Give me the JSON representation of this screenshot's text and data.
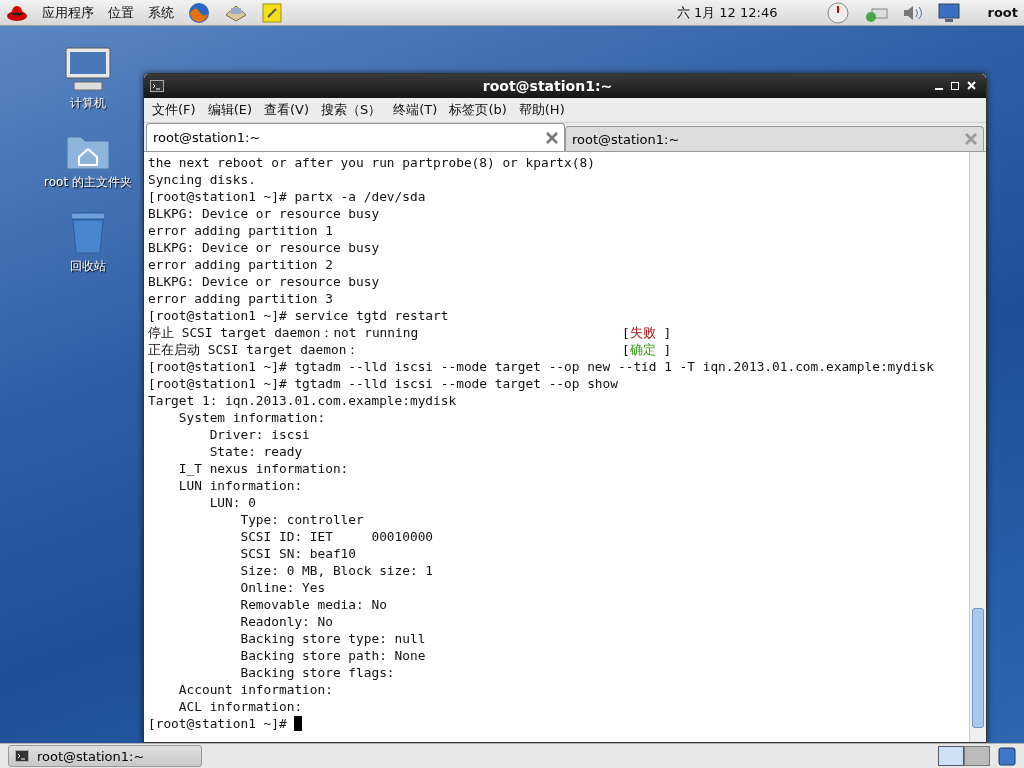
{
  "top_panel": {
    "menus": [
      "应用程序",
      "位置",
      "系统"
    ],
    "clock": "六 1月 12 12:46",
    "user": "root"
  },
  "desktop_icons": [
    {
      "kind": "computer",
      "label": "计算机"
    },
    {
      "kind": "home",
      "label": "root 的主文件夹"
    },
    {
      "kind": "trash",
      "label": "回收站"
    }
  ],
  "window": {
    "title": "root@station1:~",
    "menu": [
      "文件(F)",
      "编辑(E)",
      "查看(V)",
      "搜索（S）",
      "终端(T)",
      "标签页(b)",
      "帮助(H)"
    ],
    "tabs": [
      {
        "label": "root@station1:~",
        "selected": true
      },
      {
        "label": "root@station1:~",
        "selected": false
      }
    ],
    "lines": [
      {
        "text": "the next reboot or after you run partprobe(8) or kpartx(8)"
      },
      {
        "text": "Syncing disks."
      },
      {
        "text": "[root@station1 ~]# partx -a /dev/sda"
      },
      {
        "text": "BLKPG: Device or resource busy"
      },
      {
        "text": "error adding partition 1"
      },
      {
        "text": "BLKPG: Device or resource busy"
      },
      {
        "text": "error adding partition 2"
      },
      {
        "text": "BLKPG: Device or resource busy"
      },
      {
        "text": "error adding partition 3"
      },
      {
        "text": "[root@station1 ~]# service tgtd restart"
      },
      {
        "text": "停止 SCSI target daemon：not running",
        "status": {
          "open": "[",
          "label": "失败",
          "close": "]",
          "color": "#b01010"
        }
      },
      {
        "text": "正在启动 SCSI target daemon：",
        "status": {
          "open": "[",
          "label": "确定",
          "close": "]",
          "color": "#3a9a10"
        }
      },
      {
        "text": "[root@station1 ~]# tgtadm --lld iscsi --mode target --op new --tid 1 -T iqn.2013.01.com.example:mydisk"
      },
      {
        "text": "[root@station1 ~]# tgtadm --lld iscsi --mode target --op show"
      },
      {
        "text": "Target 1: iqn.2013.01.com.example:mydisk"
      },
      {
        "text": "    System information:"
      },
      {
        "text": "        Driver: iscsi"
      },
      {
        "text": "        State: ready"
      },
      {
        "text": "    I_T nexus information:"
      },
      {
        "text": "    LUN information:"
      },
      {
        "text": "        LUN: 0"
      },
      {
        "text": "            Type: controller"
      },
      {
        "text": "            SCSI ID: IET     00010000"
      },
      {
        "text": "            SCSI SN: beaf10"
      },
      {
        "text": "            Size: 0 MB, Block size: 1"
      },
      {
        "text": "            Online: Yes"
      },
      {
        "text": "            Removable media: No"
      },
      {
        "text": "            Readonly: No"
      },
      {
        "text": "            Backing store type: null"
      },
      {
        "text": "            Backing store path: None"
      },
      {
        "text": "            Backing store flags:"
      },
      {
        "text": "    Account information:"
      },
      {
        "text": "    ACL information:"
      },
      {
        "text": "[root@station1 ~]# ",
        "cursor": true
      }
    ]
  },
  "taskbar": {
    "tasks": [
      {
        "label": "root@station1:~"
      }
    ]
  }
}
